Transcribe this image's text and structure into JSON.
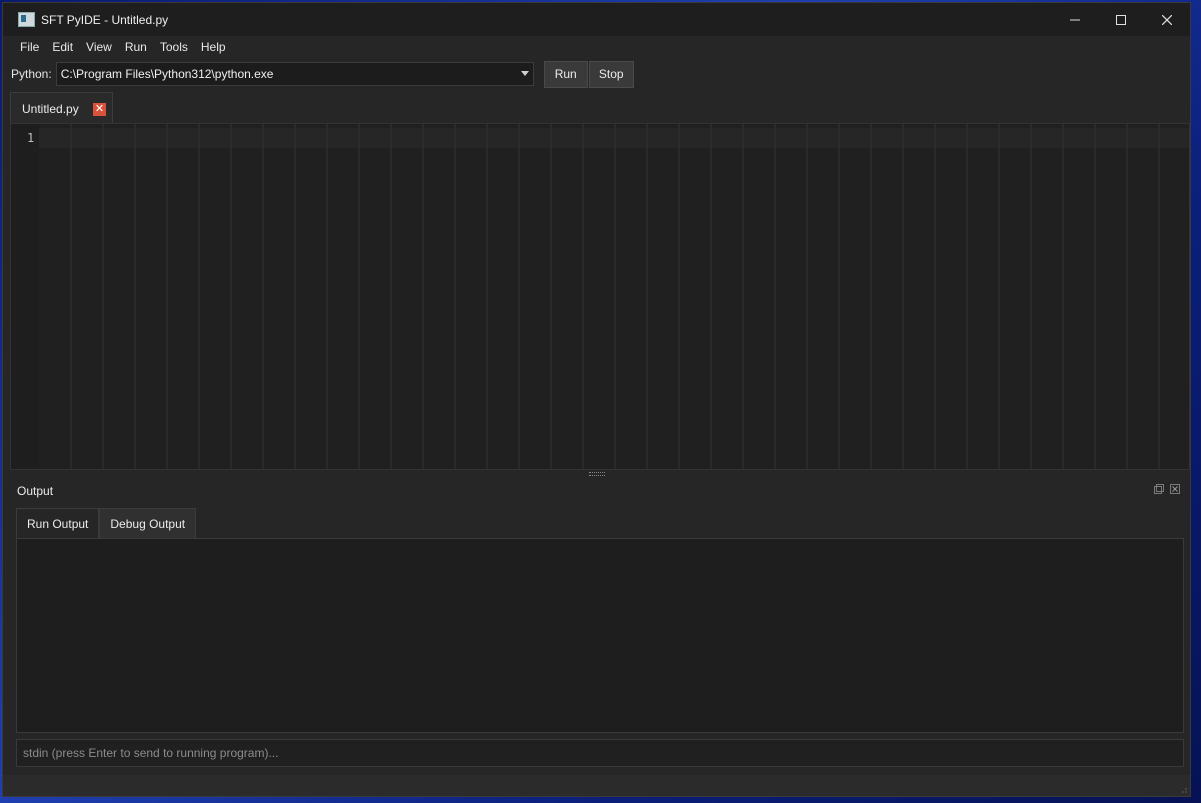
{
  "window": {
    "title": "SFT PyIDE - Untitled.py",
    "controls": {
      "minimize": "—",
      "maximize": "☐",
      "close": "✕"
    }
  },
  "menu": [
    "File",
    "Edit",
    "View",
    "Run",
    "Tools",
    "Help"
  ],
  "toolbar": {
    "python_label": "Python:",
    "interpreter_path": "C:\\Program Files\\Python312\\python.exe",
    "run_label": "Run",
    "stop_label": "Stop"
  },
  "editor": {
    "tab_label": "Untitled.py",
    "close_glyph": "✕",
    "line_numbers": [
      "1"
    ]
  },
  "output": {
    "title": "Output",
    "tabs": [
      "Run Output",
      "Debug Output"
    ],
    "stdin_placeholder": "stdin (press Enter to send to running program)..."
  },
  "icons": {
    "app": "app-window-icon",
    "float": "float-dock-icon",
    "close_dock": "close-dock-icon"
  },
  "colors": {
    "desktop": "#1f3fb0",
    "window_bg": "#262626",
    "editor_bg": "#202020",
    "close_tab": "#d9533c"
  }
}
